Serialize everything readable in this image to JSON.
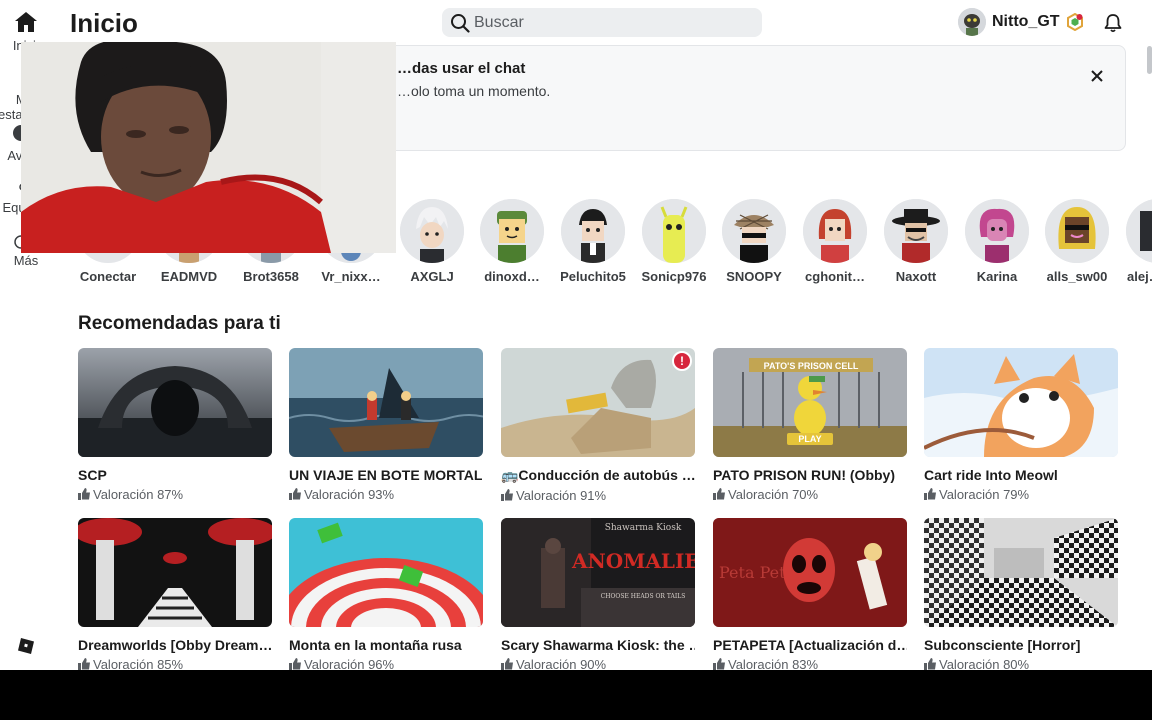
{
  "header": {
    "title": "Inicio",
    "search_placeholder": "Buscar",
    "username": "Nitto_GT"
  },
  "sidebar": {
    "items": [
      {
        "label": "Inicio",
        "icon": "home-icon"
      },
      {
        "label": "Mis estadísticas",
        "icon": "chart-icon"
      },
      {
        "label": "Avatar",
        "icon": "avatar-icon"
      },
      {
        "label": "Equipos",
        "icon": "team-icon"
      },
      {
        "label": "Más",
        "icon": "more-icon"
      }
    ]
  },
  "banner": {
    "title": "…das usar el chat",
    "text": "…olo toma un momento."
  },
  "friends": [
    {
      "name": "Conectar",
      "color": "#e4e6e9"
    },
    {
      "name": "EADMVD",
      "color": "#c9a070"
    },
    {
      "name": "Brot3658",
      "color": "#8a9aa8"
    },
    {
      "name": "Vr_nixx…",
      "color": "#5d86b9"
    },
    {
      "name": "AXGLJ",
      "color": "#e4e6e9"
    },
    {
      "name": "dinoxd…",
      "color": "#e4e6e9"
    },
    {
      "name": "Peluchito5",
      "color": "#e4e6e9"
    },
    {
      "name": "Sonicp976",
      "color": "#e4e6e9"
    },
    {
      "name": "SNOOPY",
      "color": "#e4e6e9"
    },
    {
      "name": "cghonit…",
      "color": "#e4e6e9"
    },
    {
      "name": "Naxott",
      "color": "#e4e6e9"
    },
    {
      "name": "Karina",
      "color": "#e4e6e9"
    },
    {
      "name": "alls_sw00",
      "color": "#e4e6e9"
    },
    {
      "name": "alej…",
      "color": "#e4e6e9"
    }
  ],
  "recommended": {
    "title": "Recomendadas para ti",
    "games": [
      {
        "name": "SCP",
        "rating": "Valoración 87%"
      },
      {
        "name": "UN VIAJE EN BOTE MORTAL",
        "rating": "Valoración 93%"
      },
      {
        "name": "🚌Conducción de autobús …",
        "rating": "Valoración 91%",
        "badge": "!"
      },
      {
        "name": "PATO PRISON RUN! (Obby)",
        "rating": "Valoración 70%"
      },
      {
        "name": "Cart ride Into Meowl",
        "rating": "Valoración 79%"
      },
      {
        "name": "Dreamworlds [Obby Dream…",
        "rating": "Valoración 85%"
      },
      {
        "name": "Monta en la montaña rusa",
        "rating": "Valoración 96%"
      },
      {
        "name": "Scary Shawarma Kiosk: the …",
        "rating": "Valoración 90%"
      },
      {
        "name": "PETAPETA [Actualización d…",
        "rating": "Valoración 83%"
      },
      {
        "name": "Subconsciente [Horror]",
        "rating": "Valoración 80%"
      }
    ],
    "thumb_text": {
      "pato": "PATO'S PRISON CELL",
      "play": "PLAY",
      "anomalies_top": "Shawarma Kiosk",
      "anomalies": "ANOMALIES",
      "anomalies_sub": "CHOOSE HEADS OR TAILS",
      "peta": "Peta Peta"
    }
  },
  "colors": {
    "accent_red": "#d7263d",
    "text_dark": "#1c1c1c",
    "search_bg": "#eceef0"
  }
}
